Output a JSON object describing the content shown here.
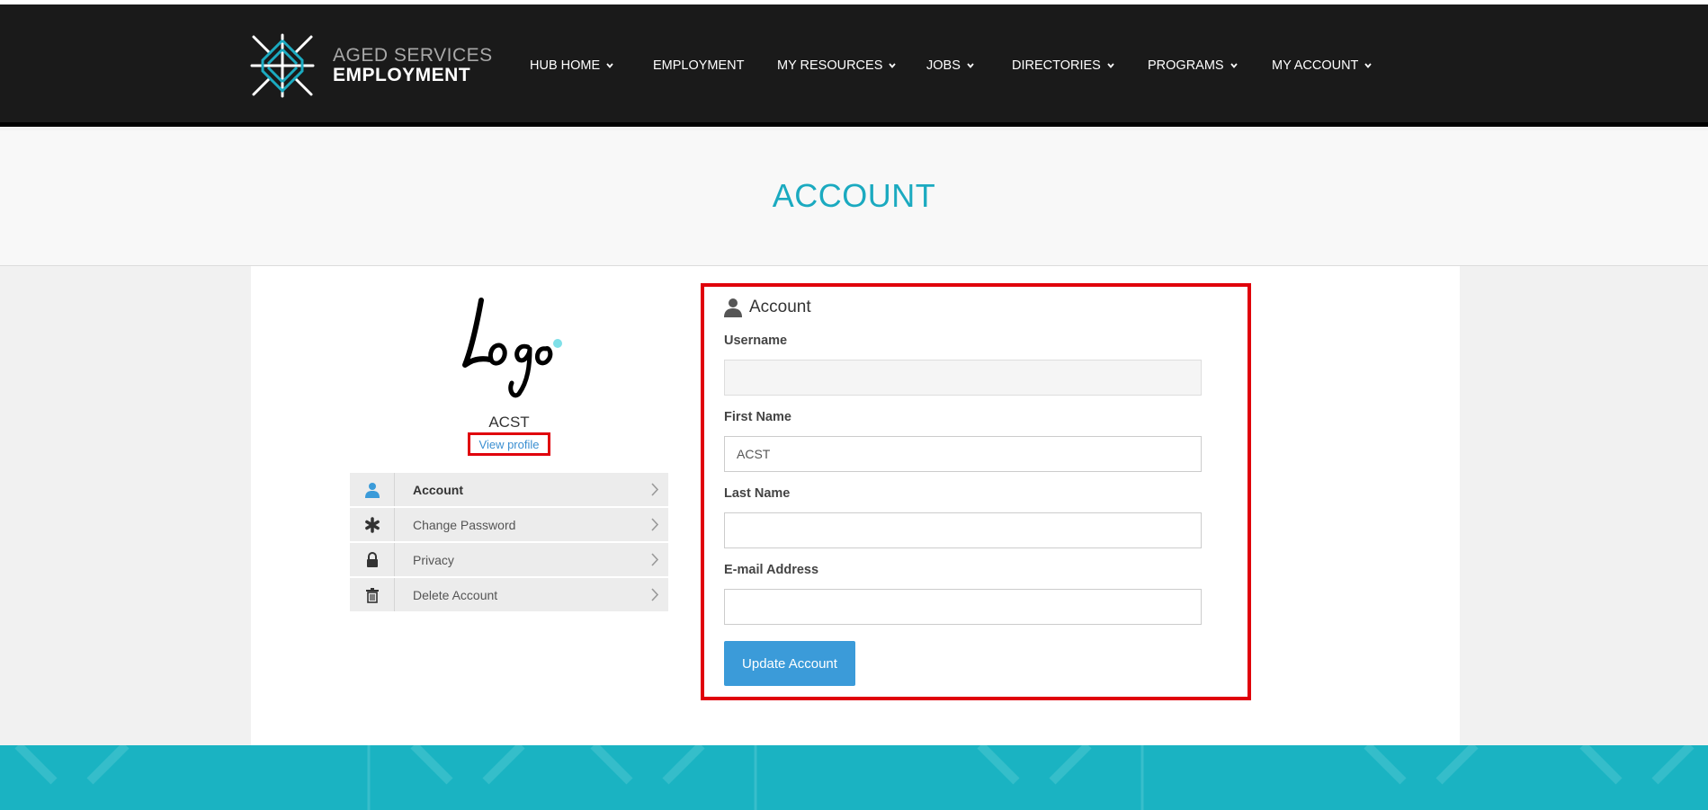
{
  "colors": {
    "accent": "#1baac0",
    "header_bg": "#1a1a1a",
    "highlight_border": "#e0000b",
    "button": "#3b9bd9",
    "footer": "#1ab3c2"
  },
  "brand": {
    "line1": "AGED SERVICES",
    "line2": "EMPLOYMENT"
  },
  "nav": [
    {
      "label": "HUB HOME",
      "has_dropdown": true
    },
    {
      "label": "EMPLOYMENT",
      "has_dropdown": false
    },
    {
      "label": "MY RESOURCES",
      "has_dropdown": true
    },
    {
      "label": "JOBS",
      "has_dropdown": true
    },
    {
      "label": "DIRECTORIES",
      "has_dropdown": true
    },
    {
      "label": "PROGRAMS",
      "has_dropdown": true
    },
    {
      "label": "MY ACCOUNT",
      "has_dropdown": true
    }
  ],
  "hero": {
    "title": "ACCOUNT"
  },
  "profile": {
    "logo_text": "Logo",
    "name": "ACST",
    "view_profile": "View profile"
  },
  "sidebar": [
    {
      "label": "Account",
      "icon": "user-icon",
      "active": true
    },
    {
      "label": "Change Password",
      "icon": "asterisk-icon",
      "active": false
    },
    {
      "label": "Privacy",
      "icon": "lock-icon",
      "active": false
    },
    {
      "label": "Delete Account",
      "icon": "trash-icon",
      "active": false
    }
  ],
  "form": {
    "title": "Account",
    "fields": [
      {
        "label": "Username",
        "value": ""
      },
      {
        "label": "First Name",
        "value": "ACST"
      },
      {
        "label": "Last Name",
        "value": ""
      },
      {
        "label": "E-mail Address",
        "value": ""
      }
    ],
    "submit": "Update Account"
  }
}
